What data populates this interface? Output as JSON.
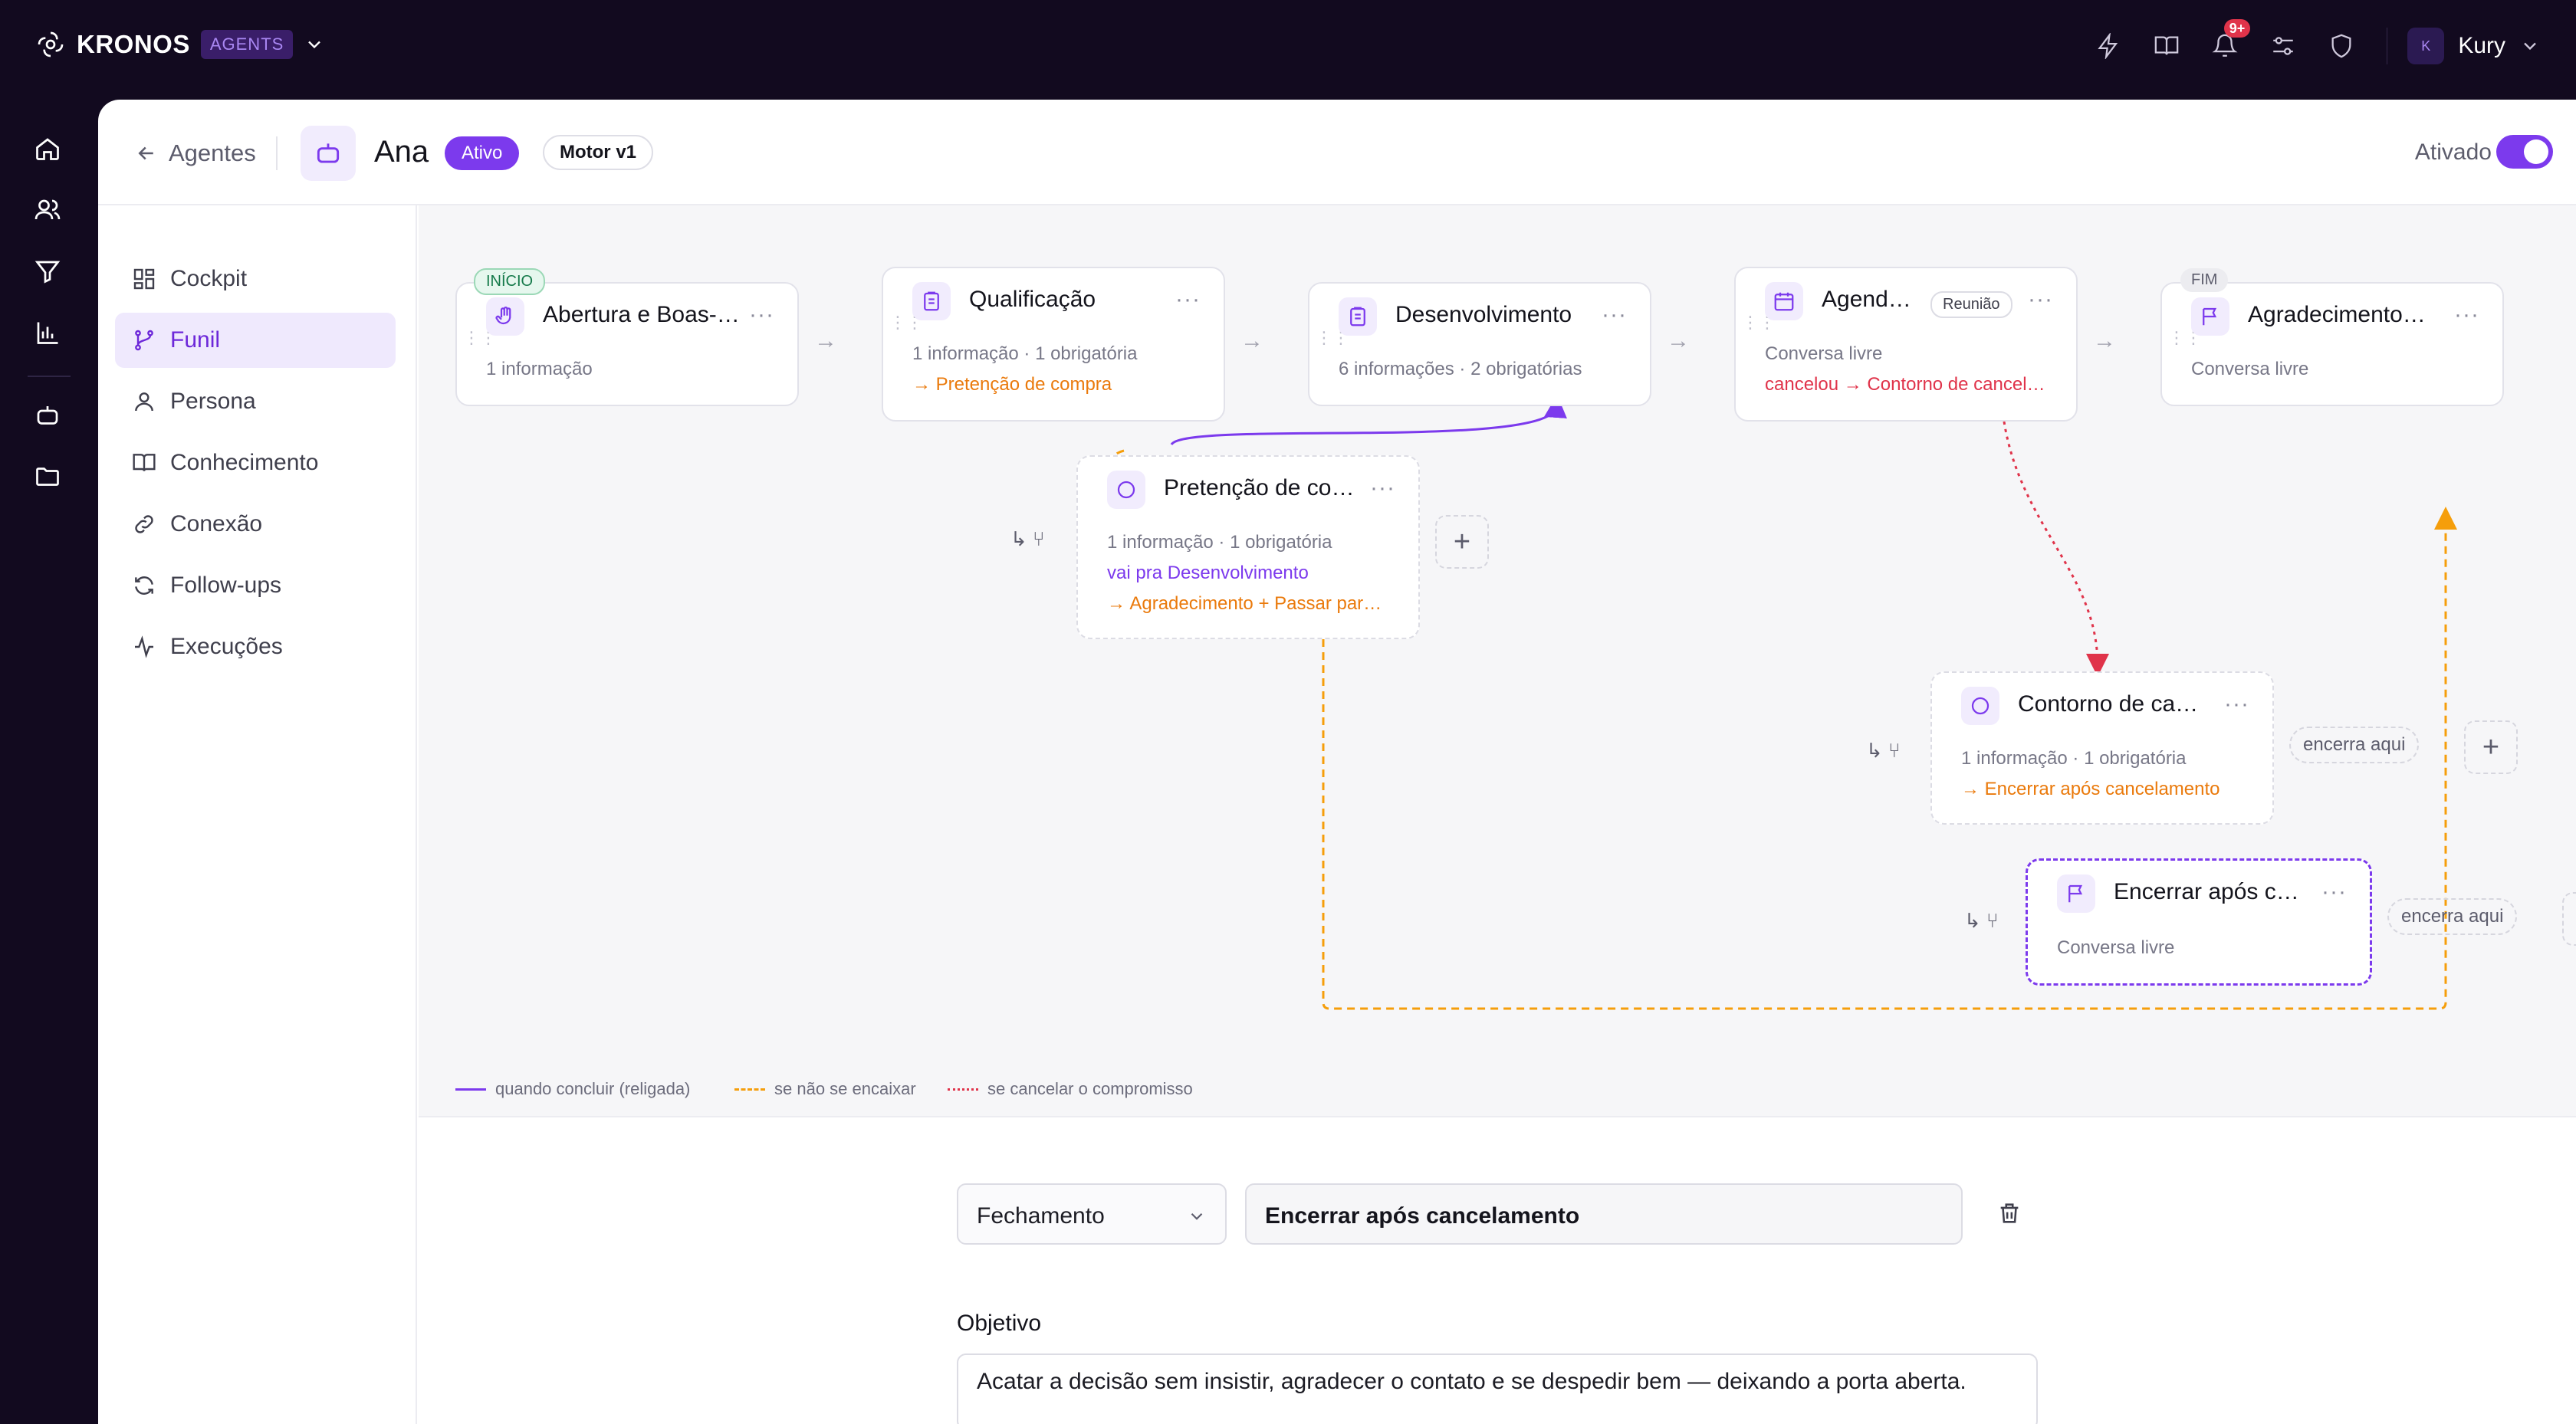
{
  "brand": {
    "name": "KRONOS",
    "tag": "AGENTS"
  },
  "topbar": {
    "notifications_badge": "9+",
    "user_initial": "K",
    "user_name": "Kury"
  },
  "header": {
    "back_label": "Agentes",
    "agent_name": "Ana",
    "status": "Ativo",
    "engine": "Motor v1",
    "enabled_label": "Ativado"
  },
  "nav": {
    "items": [
      "Cockpit",
      "Funil",
      "Persona",
      "Conhecimento",
      "Conexão",
      "Follow-ups",
      "Execuções"
    ],
    "active": "Funil"
  },
  "funnel": {
    "nodes": [
      {
        "title": "Abertura e Boas-vindas",
        "tag": "INÍCIO",
        "lines": [
          "1 informação"
        ]
      },
      {
        "title": "Qualificação",
        "lines": [
          "1 informação · 1 obrigatória",
          "→ Pretenção de compra"
        ]
      },
      {
        "title": "Desenvolvimento",
        "lines": [
          "6 informações · 2 obrigatórias"
        ]
      },
      {
        "title": "Agendamento",
        "tag": "Reunião",
        "lines": [
          "Conversa livre",
          "cancelou → Contorno de cancelamento"
        ]
      },
      {
        "title": "Agradecimento final",
        "tag": "FIM",
        "lines": [
          "Conversa livre"
        ]
      },
      {
        "title": "Pretenção de compra",
        "lines": [
          "1 informação · 1 obrigatória",
          "vai pra Desenvolvimento",
          "→ Agradecimento + Passar para humano"
        ]
      },
      {
        "title": "Contorno de cancelamento",
        "lines": [
          "1 informação · 1 obrigatória",
          "→ Encerrar após cancelamento"
        ]
      },
      {
        "title": "Encerrar após cancelamento",
        "lines": [
          "Conversa livre"
        ]
      }
    ],
    "encerra_label": "encerra aqui",
    "legend": [
      "quando concluir (religada)",
      "se não se encaixar",
      "se cancelar o compromisso"
    ],
    "colors": {
      "purple": "#7c3aed",
      "orange": "#f59e0b",
      "red": "#e0334a"
    }
  },
  "form": {
    "type_value": "Fechamento",
    "name_value": "Encerrar após cancelamento",
    "objective_label": "Objetivo",
    "objective_value": "Acatar a decisão sem insistir, agradecer o contato e se despedir bem — deixando a porta aberta."
  }
}
